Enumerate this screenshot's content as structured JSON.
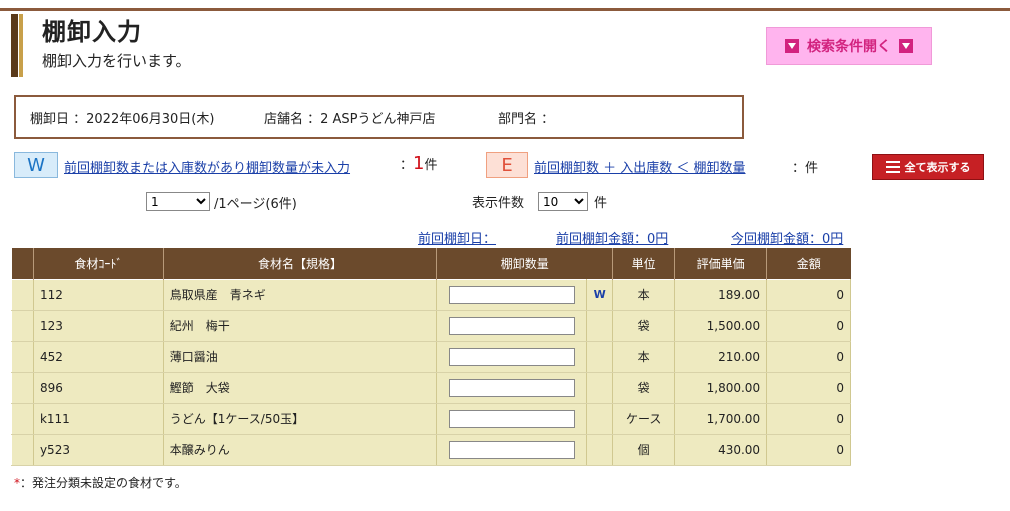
{
  "header": {
    "title": "棚卸入力",
    "subtitle": "棚卸入力を行います。",
    "search_toggle_label": "検索条件開く"
  },
  "info": {
    "date": "棚卸日 ：2022年06月30日(木)",
    "store": "店舗名 ：2 ASPうどん神戸店",
    "dept": "部門名 ："
  },
  "alerts": {
    "w_badge": "W",
    "w_text": "前回棚卸数または入庫数があり棚卸数量が未入力",
    "w_sep": "：",
    "w_count": "1",
    "w_unit": "件",
    "e_badge": "E",
    "e_text": "前回棚卸数 ＋ 入出庫数 ＜ 棚卸数量",
    "e_count": "：件",
    "show_all_label": "全て表示する"
  },
  "paging": {
    "page_value": "1",
    "page_info": "/1ページ(6件)",
    "display_label": "表示件数",
    "display_value": "10",
    "display_unit": "件"
  },
  "summary": {
    "prev_date": "前回棚卸日：",
    "prev_amount": "前回棚卸金額：0円",
    "curr_amount": "今回棚卸金額：0円"
  },
  "table": {
    "headers": [
      "食材ｺｰﾄﾞ",
      "食材名【規格】",
      "棚卸数量",
      "単位",
      "評価単価",
      "金額"
    ],
    "rows": [
      {
        "code": "112",
        "name": "鳥取県産　青ネギ",
        "qty": "",
        "flag": "W",
        "unit": "本",
        "price": "189.00",
        "amount": "0"
      },
      {
        "code": "123",
        "name": "紀州　梅干",
        "qty": "",
        "flag": "",
        "unit": "袋",
        "price": "1,500.00",
        "amount": "0"
      },
      {
        "code": "452",
        "name": "薄口醤油",
        "qty": "",
        "flag": "",
        "unit": "本",
        "price": "210.00",
        "amount": "0"
      },
      {
        "code": "896",
        "name": "鰹節　大袋",
        "qty": "",
        "flag": "",
        "unit": "袋",
        "price": "1,800.00",
        "amount": "0"
      },
      {
        "code": "k111",
        "name": "うどん【1ケース/50玉】",
        "qty": "",
        "flag": "",
        "unit": "ケース",
        "price": "1,700.00",
        "amount": "0"
      },
      {
        "code": "y523",
        "name": "本醸みりん",
        "qty": "",
        "flag": "",
        "unit": "個",
        "price": "430.00",
        "amount": "0"
      }
    ]
  },
  "footnote": {
    "mark": "*",
    "text": "：発注分類未設定の食材です。"
  }
}
